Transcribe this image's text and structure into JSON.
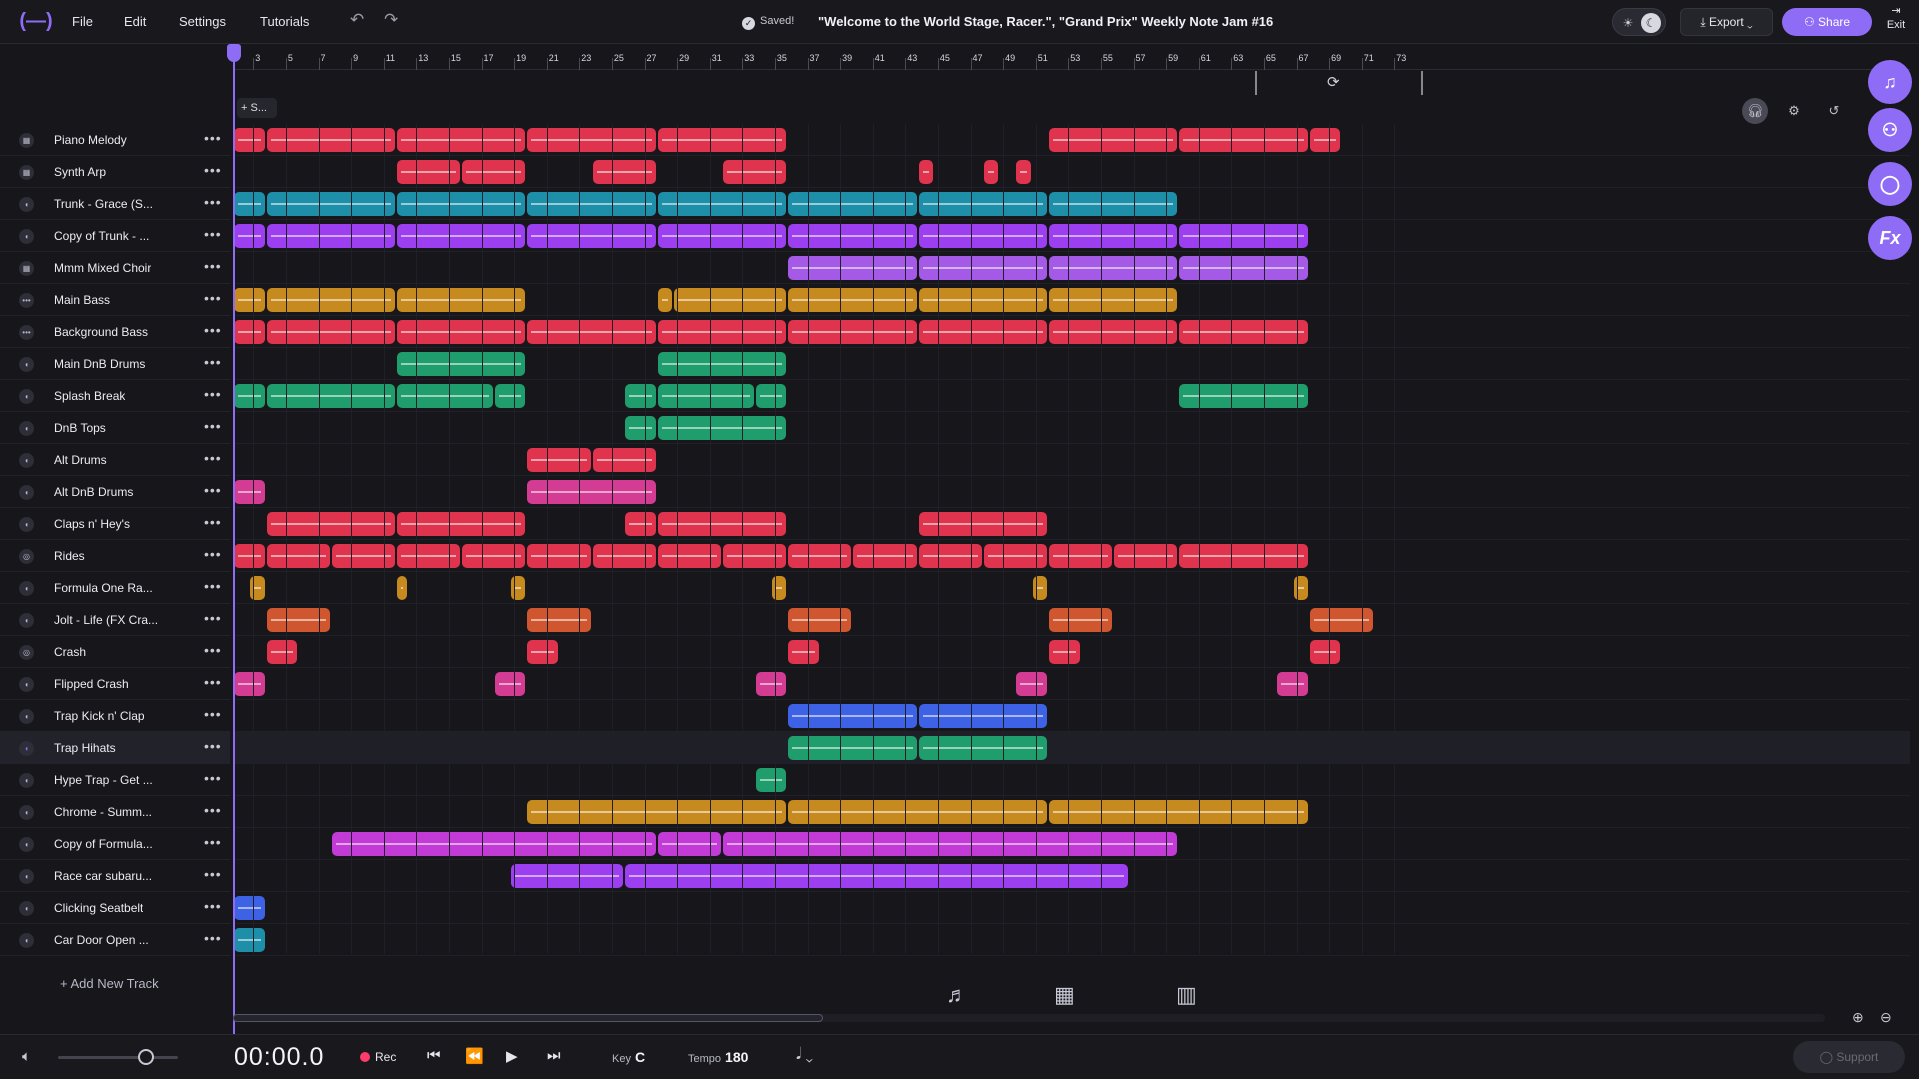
{
  "topbar": {
    "logo": "(—)",
    "menu": [
      "File",
      "Edit",
      "Settings",
      "Tutorials"
    ],
    "saved_label": "Saved!",
    "project_title": "\"Welcome to the World Stage, Racer.\", \"Grand Prix\" Weekly Note Jam #16",
    "export_label": "Export",
    "share_label": "Share",
    "exit_label": "Exit"
  },
  "ruler": {
    "bars": [
      "3",
      "5",
      "7",
      "9",
      "11",
      "13",
      "15",
      "17",
      "19",
      "21",
      "23",
      "25",
      "27",
      "29",
      "31",
      "33",
      "35",
      "37",
      "39",
      "41",
      "43",
      "45",
      "47",
      "49",
      "51",
      "53",
      "55",
      "57",
      "59",
      "61",
      "63",
      "65",
      "67",
      "69",
      "71",
      "73"
    ]
  },
  "section_label": "S...",
  "tracks": [
    {
      "name": "Piano Melody",
      "icon": "grid-icon"
    },
    {
      "name": "Synth Arp",
      "icon": "grid-icon"
    },
    {
      "name": "Trunk - Grace (S...",
      "icon": "wave-icon"
    },
    {
      "name": "Copy of Trunk - ...",
      "icon": "wave-icon"
    },
    {
      "name": "Mmm Mixed Choir",
      "icon": "grid-icon"
    },
    {
      "name": "Main Bass",
      "icon": "bass-icon"
    },
    {
      "name": "Background Bass",
      "icon": "bass-icon"
    },
    {
      "name": "Main DnB Drums",
      "icon": "wave-icon"
    },
    {
      "name": "Splash Break",
      "icon": "wave-icon"
    },
    {
      "name": "DnB Tops",
      "icon": "wave-icon"
    },
    {
      "name": "Alt Drums",
      "icon": "wave-icon"
    },
    {
      "name": "Alt DnB Drums",
      "icon": "wave-icon"
    },
    {
      "name": "Claps n' Hey's",
      "icon": "wave-icon"
    },
    {
      "name": "Rides",
      "icon": "drum-icon"
    },
    {
      "name": "Formula One Ra...",
      "icon": "wave-icon"
    },
    {
      "name": "Jolt - Life (FX Cra...",
      "icon": "wave-icon"
    },
    {
      "name": "Crash",
      "icon": "drum-icon"
    },
    {
      "name": "Flipped Crash",
      "icon": "wave-icon"
    },
    {
      "name": "Trap Kick n' Clap",
      "icon": "wave-icon"
    },
    {
      "name": "Trap Hihats",
      "icon": "wave-icon",
      "selected": true
    },
    {
      "name": "Hype Trap - Get ...",
      "icon": "wave-icon"
    },
    {
      "name": "Chrome - Summ...",
      "icon": "wave-icon"
    },
    {
      "name": "Copy of Formula...",
      "icon": "wave-icon"
    },
    {
      "name": "Race car subaru...",
      "icon": "wave-icon"
    },
    {
      "name": "Clicking Seatbelt",
      "icon": "wave-icon"
    },
    {
      "name": "Car Door Open ...",
      "icon": "wave-icon"
    }
  ],
  "add_track_label": "+ Add New Track",
  "transport": {
    "time": "00:00.0",
    "rec_label": "Rec",
    "key_label": "Key",
    "key_value": "C",
    "tempo_label": "Tempo",
    "tempo_value": "180",
    "support_label": "Support"
  },
  "colors": {
    "accent": "#8f6cf6",
    "red": "#e0334d",
    "teal": "#1d8fa8",
    "purple": "#9b3ff0",
    "lavender": "#a45ae6",
    "gold": "#c78a1f",
    "green": "#1f9d6c",
    "pink": "#d43c93",
    "orange": "#d0562f",
    "blue": "#3d62e6",
    "magenta": "#c23bd6"
  }
}
